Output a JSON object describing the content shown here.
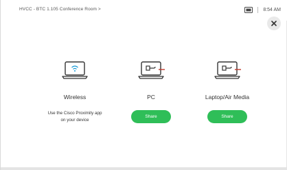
{
  "header": {
    "room_title": "HVCC - BTC 1.105 Conference Room >",
    "time": "8:54 AM",
    "status_icon": "screen-share-icon"
  },
  "close_icon": "close-icon",
  "options": [
    {
      "id": "wireless",
      "label": "Wireless",
      "icon": "laptop-wifi-icon",
      "description_line1": "Use the Cisco Proximity app",
      "description_line2": "on your device"
    },
    {
      "id": "pc",
      "label": "PC",
      "icon": "laptop-cable-icon",
      "button_label": "Share"
    },
    {
      "id": "laptop",
      "label": "Laptop/Air Media",
      "icon": "laptop-cable-icon",
      "button_label": "Share"
    }
  ],
  "colors": {
    "share_button": "#2fbe58",
    "close_bg": "#e9e9e9"
  }
}
